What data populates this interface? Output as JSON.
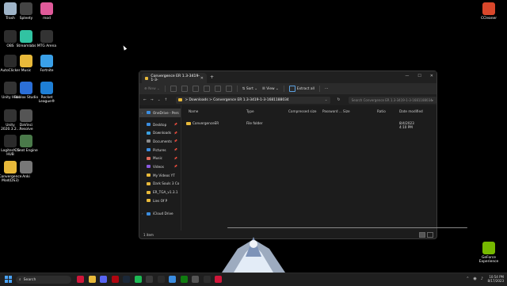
{
  "desktop": {
    "icons": [
      {
        "label": "Trash",
        "icon": "recycle-bin-icon",
        "color": "#9fb4c8"
      },
      {
        "label": "Spleety",
        "icon": "spleety-icon",
        "color": "#444444"
      },
      {
        "label": "mod",
        "icon": "mod-icon",
        "color": "#e05a9a"
      },
      {
        "label": "OBS",
        "icon": "obs-icon",
        "color": "#2d2d2d"
      },
      {
        "label": "Streamlabs",
        "icon": "streamlabs-icon",
        "color": "#31c3a2"
      },
      {
        "label": "MTG Arena",
        "icon": "mtg-arena-icon",
        "color": "#333333"
      },
      {
        "label": "AutoClicker",
        "icon": "autoclicker-icon",
        "color": "#2b2b2b"
      },
      {
        "label": "Music",
        "icon": "folder-icon",
        "color": "#e8b93a"
      },
      {
        "label": "Fortnite",
        "icon": "fortnite-icon",
        "color": "#3aa0e8"
      },
      {
        "label": "Unity Hub",
        "icon": "unity-hub-icon",
        "color": "#333333"
      },
      {
        "label": "Roblox Studio",
        "icon": "roblox-studio-icon",
        "color": "#2b6fd8"
      },
      {
        "label": "Rocket League®",
        "icon": "rocket-league-icon",
        "color": "#1e7fd6"
      },
      {
        "label": "Unity 2020.3.2...",
        "icon": "unity-icon",
        "color": "#333333"
      },
      {
        "label": "DaVinci Resolve",
        "icon": "davinci-resolve-icon",
        "color": "#555555"
      },
      {
        "label": "Logitech G HUB",
        "icon": "logitech-ghub-icon",
        "color": "#2a2a2a"
      },
      {
        "label": "Cheat Engine",
        "icon": "cheat-engine-icon",
        "color": "#4a7a4a"
      },
      {
        "label": "Convergence Mod(DS3)",
        "icon": "folder-icon",
        "color": "#e8b93a"
      },
      {
        "label": "Anki",
        "icon": "anki-icon",
        "color": "#777777"
      },
      {
        "label": "CCleaner",
        "icon": "ccleaner-icon",
        "color": "#d9472b"
      },
      {
        "label": "GeForce Experience",
        "icon": "geforce-experience-icon",
        "color": "#76b900"
      }
    ]
  },
  "explorer": {
    "tab_title": "Convergence ER 1.3-3419-1-3-",
    "window_controls": [
      "—",
      "☐",
      "✕"
    ],
    "new_tab": "+",
    "toolbar": {
      "new_label": "New",
      "sort_label": "Sort",
      "view_label": "View",
      "extract_label": "Extract all",
      "more_label": "···"
    },
    "nav_buttons": [
      "←",
      "→",
      "⌄",
      "↑"
    ],
    "address": {
      "crumb_1": "Downloads",
      "separator": ">",
      "crumb_2": "Convergence ER 1.3-3419-1-3-1681188034"
    },
    "search_placeholder": "Search Convergence ER 1.3-3419-1-3-1681188034",
    "sidebar": [
      {
        "label": "OneDrive - Pers",
        "icon": "onedrive-icon",
        "color": "#3b8de0",
        "selected": true
      },
      {
        "label": "Desktop",
        "icon": "desktop-icon",
        "color": "#3b8de0",
        "pinned": true
      },
      {
        "label": "Downloads",
        "icon": "downloads-icon",
        "color": "#3ba0e0",
        "pinned": true
      },
      {
        "label": "Documents",
        "icon": "documents-icon",
        "color": "#8a8a8a",
        "pinned": true
      },
      {
        "label": "Pictures",
        "icon": "pictures-icon",
        "color": "#3b8de0",
        "pinned": true
      },
      {
        "label": "Music",
        "icon": "music-icon",
        "color": "#e06a5a",
        "pinned": true
      },
      {
        "label": "Videos",
        "icon": "videos-icon",
        "color": "#8a5ae0",
        "pinned": true
      },
      {
        "label": "My Videos YT",
        "icon": "folder-icon",
        "color": "#e8b93a"
      },
      {
        "label": "Dark Souls 3 Co",
        "icon": "folder-icon",
        "color": "#e8b93a"
      },
      {
        "label": "ER_TGA_v1.3.1",
        "icon": "folder-icon",
        "color": "#e8b93a"
      },
      {
        "label": "Lies Of P",
        "icon": "folder-icon",
        "color": "#e8b93a"
      },
      {
        "label": "iCloud Drive",
        "icon": "icloud-drive-icon",
        "color": "#3b8de0"
      }
    ],
    "columns": [
      "Name",
      "Type",
      "Compressed size",
      "Password ...",
      "Size",
      "Ratio",
      "Date modified"
    ],
    "rows": [
      {
        "name": "ConvergenceER",
        "type": "File folder",
        "compressed": "",
        "password": "",
        "size": "",
        "ratio": "",
        "date": "8/4/2023 4:10 PM"
      }
    ],
    "status": "1 item"
  },
  "taskbar": {
    "search_label": "Search",
    "apps": [
      {
        "icon": "opera-gx-icon",
        "color": "#d0163a"
      },
      {
        "icon": "file-explorer-icon",
        "color": "#e8b93a"
      },
      {
        "icon": "discord-icon",
        "color": "#5865f2"
      },
      {
        "icon": "netflix-icon",
        "color": "#b00610"
      },
      {
        "icon": "steam-icon",
        "color": "#1b2838"
      },
      {
        "icon": "spotify-icon",
        "color": "#1db954"
      },
      {
        "icon": "calculator-icon",
        "color": "#3a3a3a"
      },
      {
        "icon": "epic-games-icon",
        "color": "#2b2b2b"
      },
      {
        "icon": "microsoft-store-icon",
        "color": "#3b8de0"
      },
      {
        "icon": "xbox-icon",
        "color": "#107c10"
      },
      {
        "icon": "settings-icon",
        "color": "#555555"
      },
      {
        "icon": "obs-icon",
        "color": "#2d2d2d"
      },
      {
        "icon": "opera-icon",
        "color": "#d0163a"
      }
    ],
    "clock_time": "10:54 PM",
    "clock_date": "8/17/2023"
  }
}
